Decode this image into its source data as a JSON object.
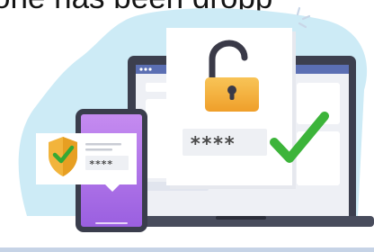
{
  "headline": "one has been dropp",
  "phone_password": "****",
  "card_password": "****",
  "icons": {
    "lock": "unlocked-padlock",
    "check": "checkmark",
    "shield": "shield-check",
    "sparkle": "sparkle-lines"
  },
  "colors": {
    "blob": "#c9e9f5",
    "laptop": "#3b3f4f",
    "phone": "#b477ea",
    "lock": "#f6b844",
    "check": "#3eb53c",
    "shield": "#f2b43c"
  }
}
